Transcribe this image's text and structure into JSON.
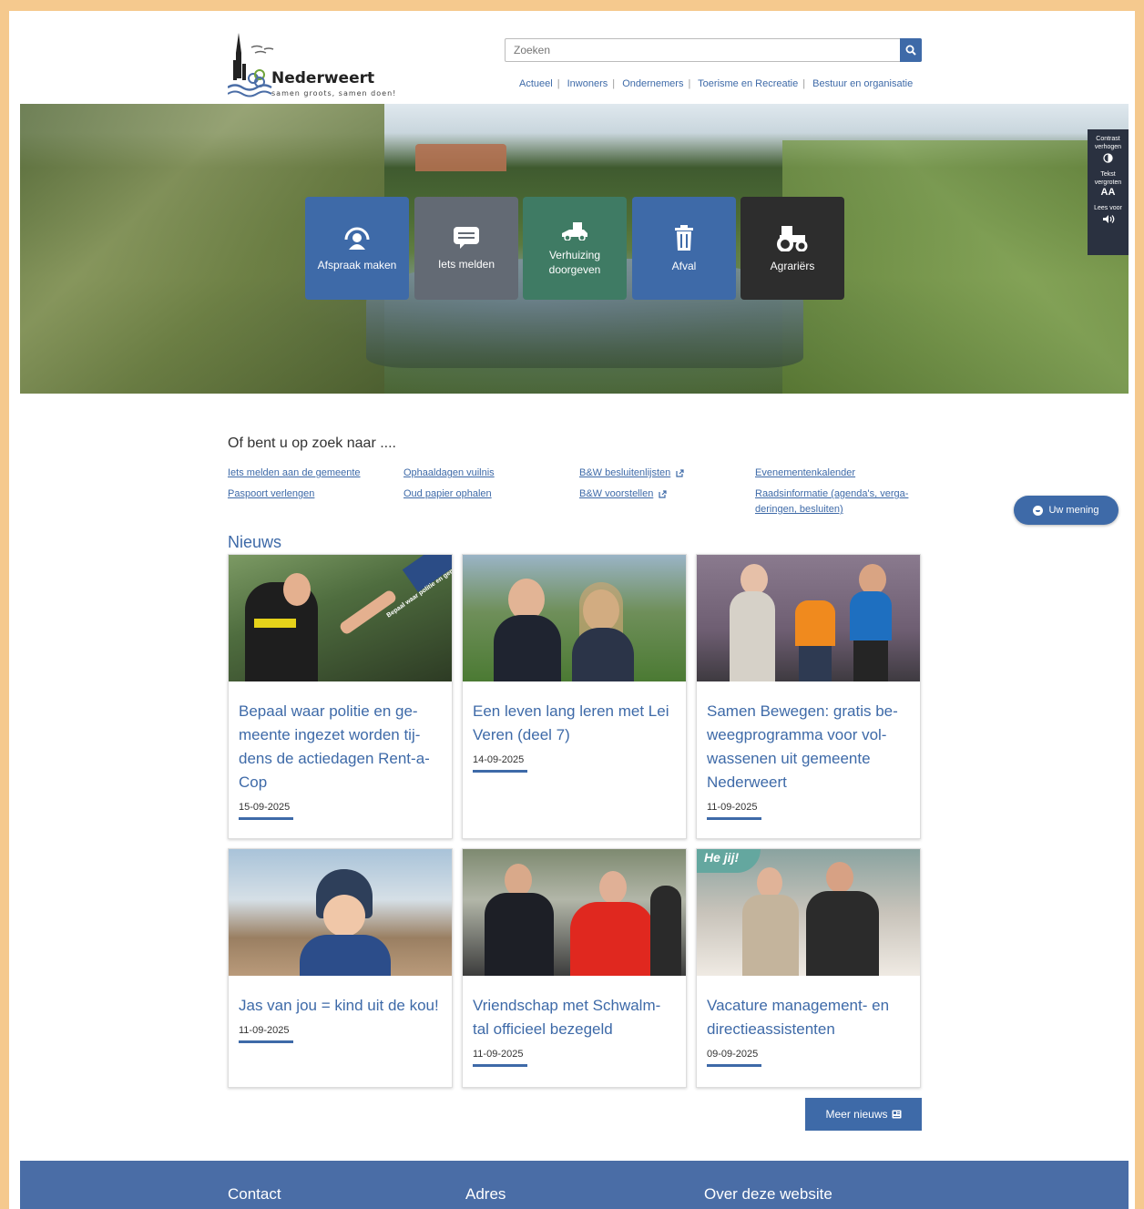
{
  "header": {
    "logo_name": "Nederweert",
    "logo_tagline": "samen groots, samen doen!",
    "search_placeholder": "Zoeken",
    "nav": [
      "Actueel",
      "Inwoners",
      "Ondernemers",
      "Toerisme en Recreatie",
      "Bestuur en organisatie"
    ]
  },
  "hero_tiles": [
    {
      "label": "Afspraak maken",
      "icon": "calendar-person-icon",
      "color": "#3e6aa8"
    },
    {
      "label": "Iets melden",
      "icon": "chat-bubble-icon",
      "color": "#636a74"
    },
    {
      "label": "Verhuizing doorgeven",
      "icon": "moving-truck-icon",
      "color": "#3f7b64"
    },
    {
      "label": "Afval",
      "icon": "trash-can-icon",
      "color": "#3e6aa8"
    },
    {
      "label": "Agrariërs",
      "icon": "tractor-icon",
      "color": "#2d2d2d"
    }
  ],
  "accessibility": {
    "contrast": "Contrast verhogen",
    "text_size": "Tekst vergroten",
    "text_size_icon": "AA",
    "read_aloud": "Lees voor"
  },
  "lookfor": {
    "title": "Of bent u op zoek naar ....",
    "columns": [
      [
        "Iets melden aan de gemeente",
        "Paspoort verlengen"
      ],
      [
        "Ophaaldagen vuilnis",
        "Oud papier ophalen"
      ],
      [
        "B&W besluitenlijsten",
        "B&W voorstellen"
      ],
      [
        "Evenementenkalender",
        "Raadsinformatie (agenda's, verga-deringen, besluiten)"
      ]
    ]
  },
  "feedback": {
    "label": "Uw mening"
  },
  "news": {
    "title": "Nieuws",
    "items": [
      {
        "title": "Bepaal waar politie en ge-meente ingezet worden tij-dens de actiedagen Rent-a-Cop",
        "date": "15-09-2025",
        "image_banner": "Bepaal waar politie en gemeente ingezet worden"
      },
      {
        "title": "Een leven lang leren met Lei Veren (deel 7)",
        "date": "14-09-2025"
      },
      {
        "title": "Samen Bewegen: gratis be-weegprogramma voor vol-wassenen uit gemeente Nederweert",
        "date": "11-09-2025"
      },
      {
        "title": "Jas van jou = kind uit de kou!",
        "date": "11-09-2025"
      },
      {
        "title": "Vriendschap met Schwalm-tal officieel bezegeld",
        "date": "11-09-2025"
      },
      {
        "title": "Vacature management- en directieassistenten",
        "date": "09-09-2025",
        "image_text": "He jij!"
      }
    ],
    "more_label": "Meer nieuws"
  },
  "footer": {
    "columns": [
      "Contact",
      "Adres",
      "Over deze website"
    ]
  },
  "colors": {
    "accent": "#3e6aa8",
    "frame": "#f5c98e",
    "footer": "#4a6da6"
  }
}
